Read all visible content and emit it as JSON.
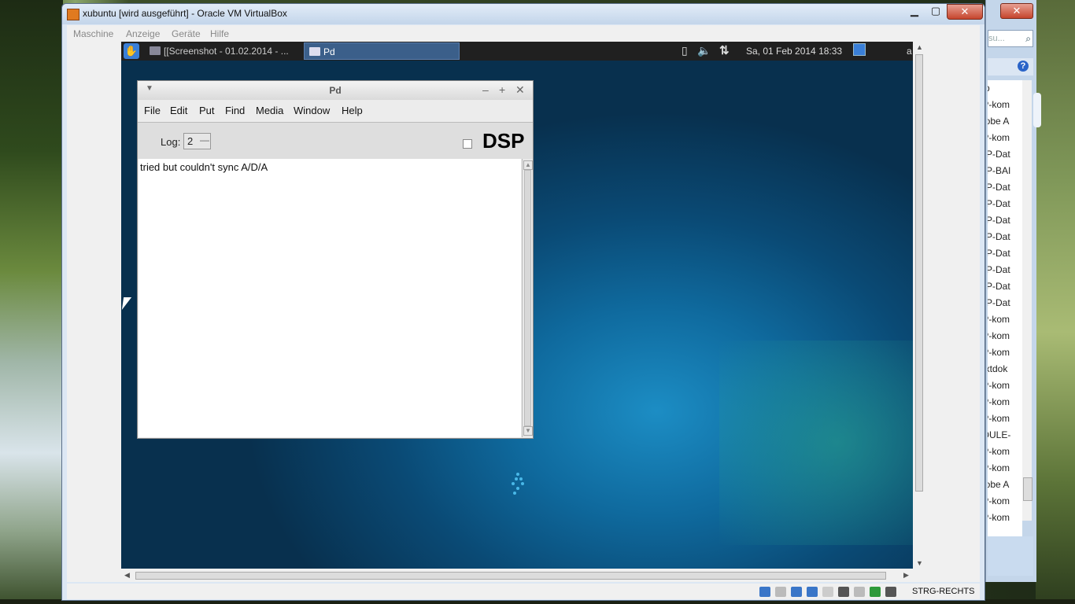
{
  "host": {
    "bg_explorer": {
      "close": "✕",
      "search_placeholder": "su...",
      "help": "?",
      "items": [
        "yp",
        "IP-kom",
        "dobe A",
        "IP-kom",
        "PP-Dat",
        "PP-BAI",
        "PP-Dat",
        "PP-Dat",
        "PP-Dat",
        "PP-Dat",
        "PP-Dat",
        "PP-Dat",
        "PP-Dat",
        "PP-Dat",
        "IP-kom",
        "IP-kom",
        "IP-kom",
        "extdok",
        "IP-kom",
        "IP-kom",
        "IP-kom",
        "IDULE-",
        "IP-kom",
        "IP-kom",
        "dobe A",
        "IP-kom",
        "IP-kom"
      ]
    }
  },
  "vbox": {
    "title": "xubuntu [wird ausgeführt] - Oracle VM VirtualBox",
    "menu": [
      "Maschine",
      "Anzeige",
      "Geräte",
      "Hilfe"
    ],
    "host_key": "STRG-RECHTS",
    "status_icon_colors": [
      "#3a76c8",
      "#bbbbbb",
      "#3a76c8",
      "#3a76c8",
      "#cccccc",
      "#555555",
      "#bbbbbb",
      "#2e9a3a",
      "#555555"
    ]
  },
  "guest": {
    "panel": {
      "tasks": [
        "[[Screenshot - 01.02.2014 - ...",
        "Pd"
      ],
      "battery": "▯",
      "volume": "🔈",
      "network": "⇅",
      "clock": "Sa, 01 Feb 2014 18:33",
      "user": "a"
    },
    "pd": {
      "title": "Pd",
      "menu": [
        "File",
        "Edit",
        "Put",
        "Find",
        "Media",
        "Window",
        "Help"
      ],
      "log_label": "Log:",
      "log_value": "2",
      "dsp_label": "DSP",
      "console_lines": [
        "tried but couldn't sync A/D/A"
      ]
    }
  },
  "colors": {
    "pd_task_active": "#3b5f8a",
    "guest_bg": "#0f6a9e",
    "spinner": "#49b8e8"
  }
}
